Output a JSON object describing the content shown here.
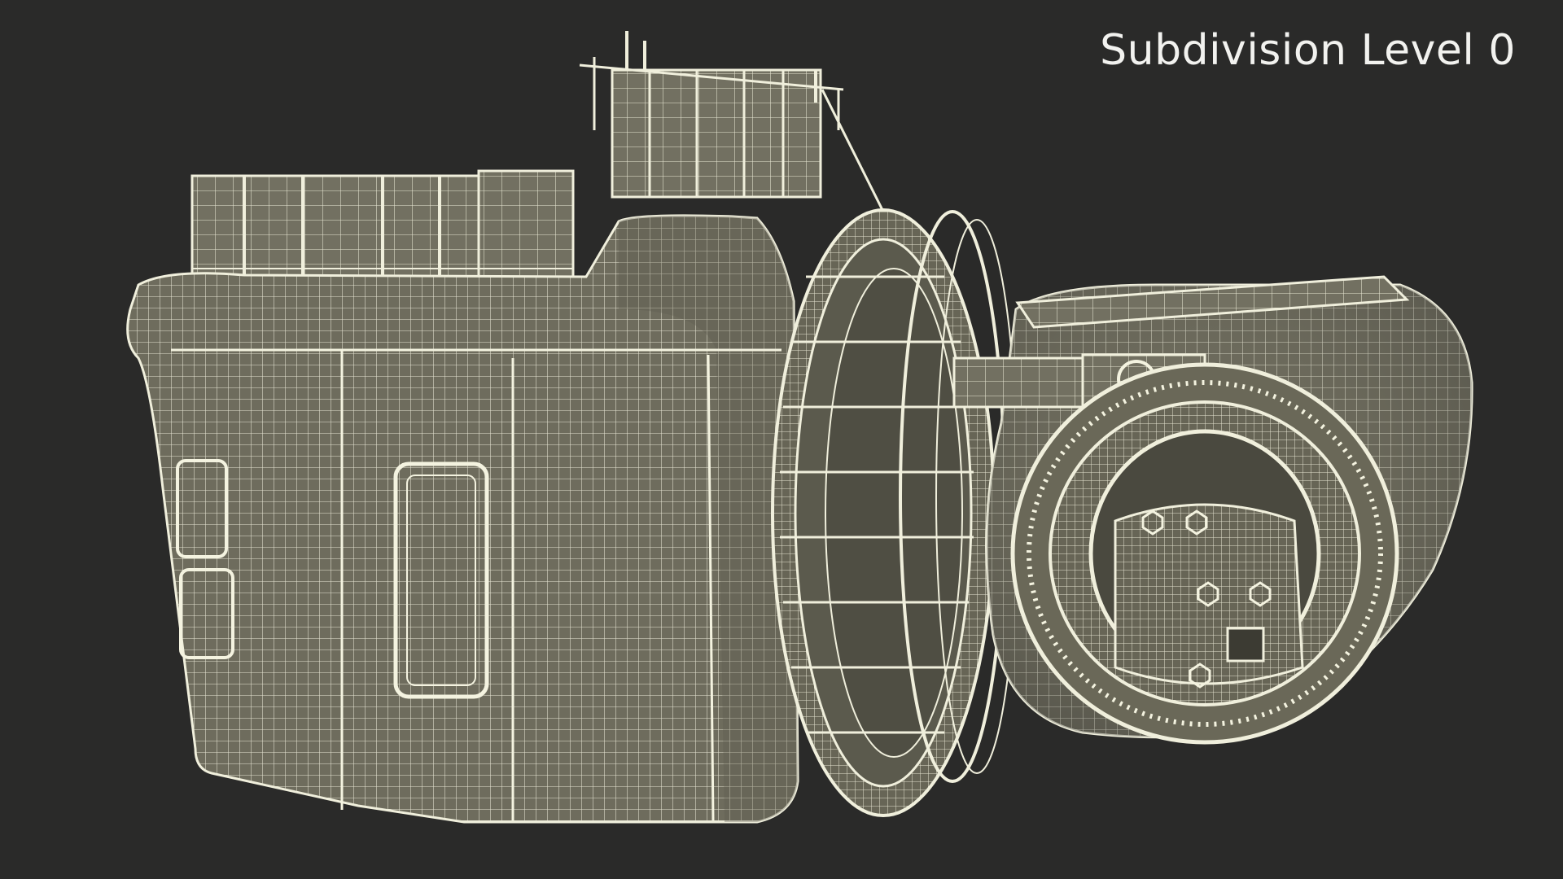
{
  "scene": {
    "caption": "Subdivision Level 0",
    "background_color": "#2a2a29",
    "surface_color": "#6e6c5d",
    "wire_color": "#ecebd8"
  }
}
